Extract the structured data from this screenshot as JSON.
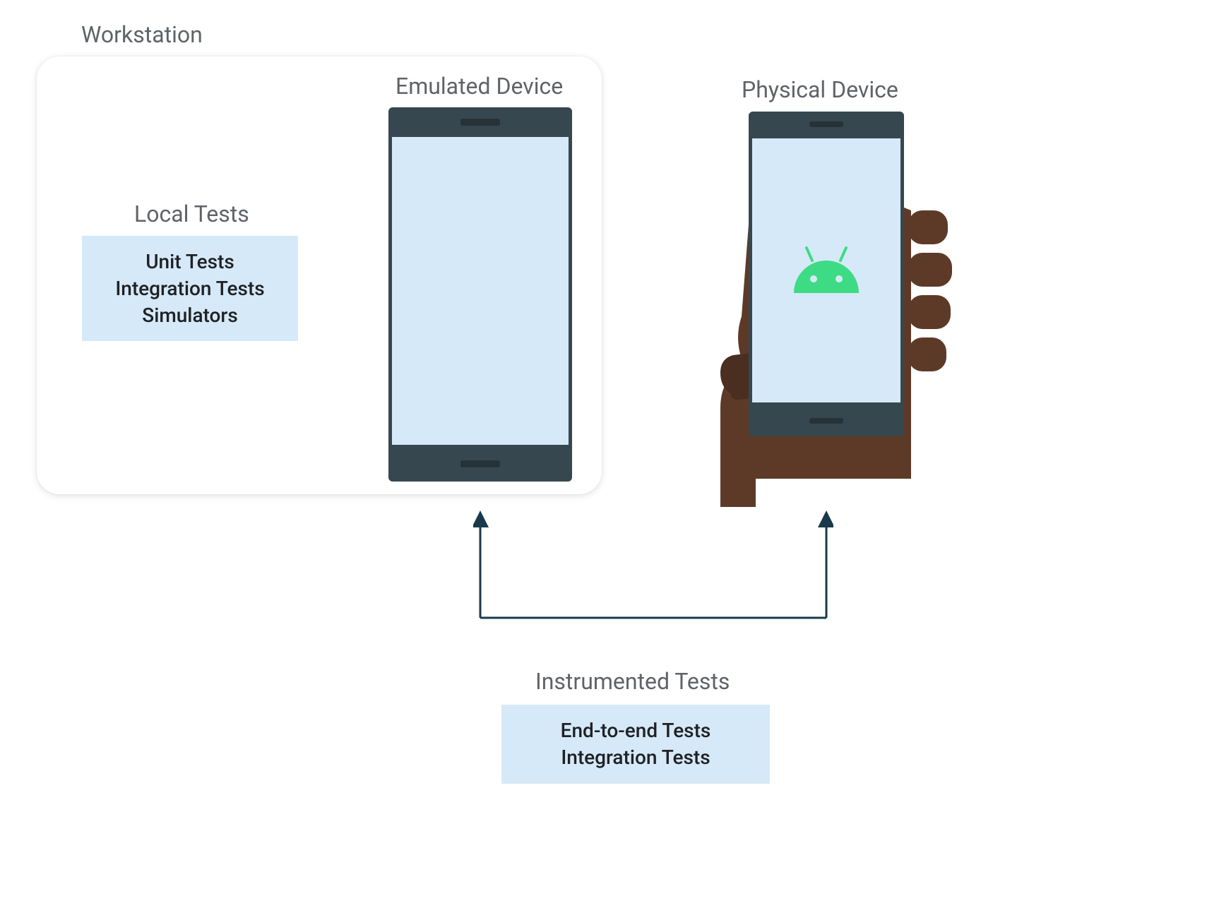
{
  "labels": {
    "workstation": "Workstation",
    "local_tests": "Local Tests",
    "emulated_device": "Emulated Device",
    "physical_device": "Physical Device",
    "instrumented_tests": "Instrumented Tests"
  },
  "local_tests_box": {
    "line1": "Unit Tests",
    "line2": "Integration Tests",
    "line3": "Simulators"
  },
  "instrumented_tests_box": {
    "line1": "End-to-end Tests",
    "line2": "Integration Tests"
  },
  "colors": {
    "accent_blue": "#d6e9f8",
    "phone_dark": "#37474f",
    "text_gray": "#5f6368",
    "text_dark": "#202124",
    "android_green": "#3ddc84",
    "hand_brown": "#5d3a28",
    "connector": "#1a3a4a"
  }
}
